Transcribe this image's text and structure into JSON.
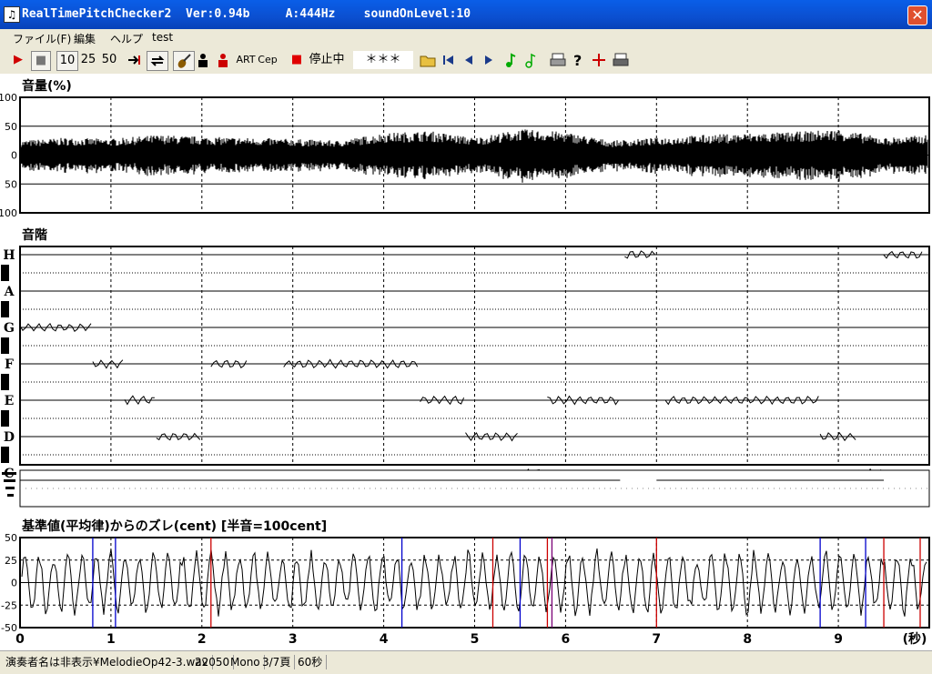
{
  "window": {
    "title": "RealTimePitchChecker2  Ver:0.94b     A:444Hz    soundOnLevel:10",
    "close_glyph": "✕",
    "app_icon_glyph": "♫"
  },
  "menu": [
    "ファイル(F)",
    "編集",
    "ヘルプ",
    "test"
  ],
  "toolbar": {
    "play_glyph": "▶",
    "stop_glyph": "■",
    "speed_options": [
      "10",
      "25",
      "50"
    ],
    "art_label": "ART",
    "cep_label": "Cep",
    "record_glyph": "■",
    "status_label": "停止中",
    "note_display": "＊＊＊"
  },
  "volume_panel": {
    "title": "音量(%)",
    "y_ticks": [
      "100",
      "50",
      "0",
      "50",
      "100"
    ]
  },
  "scale_panel": {
    "title": "音階",
    "note_labels": [
      "H",
      "A",
      "G",
      "F",
      "E",
      "D",
      "C"
    ]
  },
  "deviation_panel": {
    "title": "基準値(平均律)からのズレ(cent) [半音=100cent]",
    "y_ticks": [
      "50",
      "25",
      "0",
      "-25",
      "-50"
    ]
  },
  "time_axis": {
    "ticks": [
      "0",
      "1",
      "2",
      "3",
      "4",
      "5",
      "6",
      "7",
      "8",
      "9"
    ],
    "unit": "(秒)"
  },
  "status_bar": {
    "filename": "演奏者名は非表示¥MelodieOp42-3.wav",
    "sample_rate": "22050",
    "channel": "Mono",
    "page": "3/7頁",
    "duration": "60秒"
  },
  "colors": {
    "titlebar": "#0b4fd0",
    "chrome": "#ece9d8",
    "record_red": "#e00000",
    "play_red": "#d00000",
    "trace": "#000000",
    "dev_blue": "#0000cc",
    "dev_red": "#cc0000"
  },
  "chart_data": [
    {
      "type": "area",
      "title": "音量(%)",
      "xlim": [
        0,
        10
      ],
      "ylim": [
        -100,
        100
      ],
      "grid": true,
      "note": "volume envelope (amplitude vs time)",
      "x": [
        0,
        0.5,
        1,
        1.5,
        2,
        2.5,
        3,
        3.5,
        4,
        4.5,
        5,
        5.5,
        6,
        6.5,
        7,
        7.5,
        8,
        8.5,
        9,
        9.5,
        10
      ],
      "y": [
        25,
        30,
        28,
        35,
        32,
        30,
        28,
        25,
        38,
        42,
        30,
        45,
        40,
        25,
        30,
        35,
        38,
        40,
        45,
        30,
        35
      ]
    },
    {
      "type": "line",
      "title": "音階",
      "xlim": [
        0,
        10
      ],
      "categories": [
        "C",
        "D",
        "E",
        "F",
        "G",
        "A",
        "H"
      ],
      "series": [
        {
          "segments": [
            {
              "x": [
                0.0,
                0.8
              ],
              "y": "G"
            },
            {
              "x": [
                0.8,
                1.15
              ],
              "y": "F"
            },
            {
              "x": [
                1.15,
                1.5
              ],
              "y": "E"
            },
            {
              "x": [
                1.5,
                2.0
              ],
              "y": "D"
            },
            {
              "x": [
                2.1,
                2.5
              ],
              "y": "F"
            },
            {
              "x": [
                2.9,
                4.4
              ],
              "y": "F"
            },
            {
              "x": [
                4.4,
                4.9
              ],
              "y": "E"
            },
            {
              "x": [
                4.9,
                5.5
              ],
              "y": "D"
            },
            {
              "x": [
                5.5,
                5.8
              ],
              "y": "C"
            },
            {
              "x": [
                5.8,
                6.6
              ],
              "y": "E"
            },
            {
              "x": [
                6.65,
                7.0
              ],
              "y": "H"
            },
            {
              "x": [
                7.1,
                8.8
              ],
              "y": "E"
            },
            {
              "x": [
                8.8,
                9.2
              ],
              "y": "D"
            },
            {
              "x": [
                9.2,
                9.5
              ],
              "y": "C"
            },
            {
              "x": [
                9.5,
                9.95
              ],
              "y": "H"
            }
          ]
        }
      ]
    },
    {
      "type": "line",
      "title": "基準値(平均律)からのズレ(cent) [半音=100cent]",
      "xlim": [
        0,
        10
      ],
      "ylim": [
        -50,
        50
      ],
      "grid": true,
      "xlabel": "(秒)"
    }
  ]
}
